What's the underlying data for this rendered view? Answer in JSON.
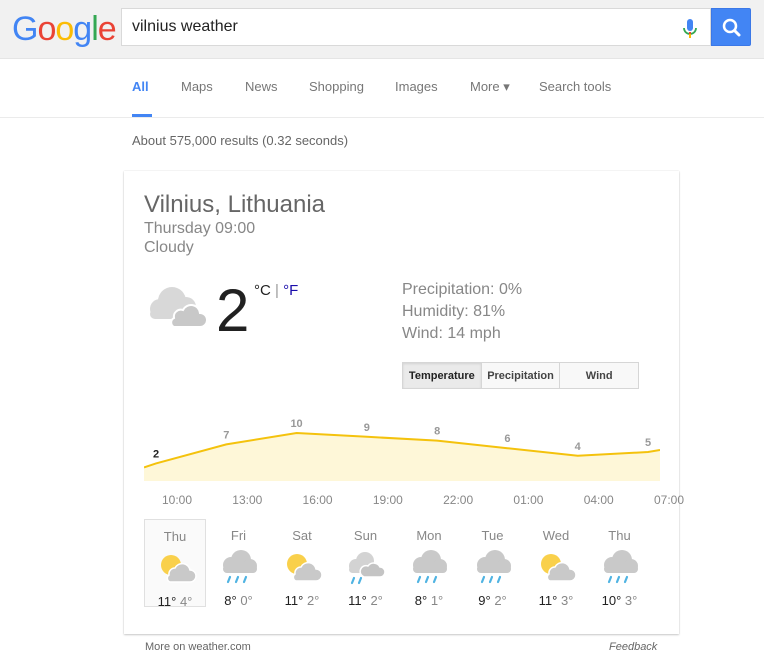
{
  "logo": {
    "letters": [
      "G",
      "o",
      "o",
      "g",
      "l",
      "e"
    ],
    "colors": [
      "#4285f4",
      "#ea4335",
      "#fbbc05",
      "#4285f4",
      "#34a853",
      "#ea4335"
    ]
  },
  "search": {
    "query": "vilnius weather"
  },
  "nav": {
    "items": [
      "All",
      "Maps",
      "News",
      "Shopping",
      "Images",
      "More ▾",
      "Search tools"
    ],
    "active": "All"
  },
  "stats": "About 575,000 results (0.32 seconds)",
  "weather": {
    "location": "Vilnius, Lithuania",
    "time": "Thursday 09:00",
    "condition": "Cloudy",
    "icon": "cloudy-icon",
    "temperature": "2",
    "unit_c": "°C",
    "unit_sep": " | ",
    "unit_f": "°F",
    "precipitation": "Precipitation: 0%",
    "humidity": "Humidity: 81%",
    "wind": "Wind: 14 mph",
    "tabs": [
      "Temperature",
      "Precipitation",
      "Wind"
    ],
    "active_tab": "Temperature",
    "hourly": {
      "labels": [
        "2",
        "7",
        "10",
        "9",
        "8",
        "6",
        "4",
        "5"
      ],
      "values": [
        2,
        7,
        10,
        9,
        8,
        6,
        4,
        5
      ],
      "times": [
        "10:00",
        "13:00",
        "16:00",
        "19:00",
        "22:00",
        "01:00",
        "04:00",
        "07:00"
      ],
      "line_color": "#f4c20d",
      "fill_color": "#fef7d8"
    },
    "daily": [
      {
        "day": "Thu",
        "icon": "partly-cloudy-icon",
        "high": "11°",
        "low": "4°",
        "selected": true
      },
      {
        "day": "Fri",
        "icon": "rain-icon",
        "high": "8°",
        "low": "0°",
        "selected": false
      },
      {
        "day": "Sat",
        "icon": "partly-cloudy-icon",
        "high": "11°",
        "low": "2°",
        "selected": false
      },
      {
        "day": "Sun",
        "icon": "showers-icon",
        "high": "11°",
        "low": "2°",
        "selected": false
      },
      {
        "day": "Mon",
        "icon": "rain-icon",
        "high": "8°",
        "low": "1°",
        "selected": false
      },
      {
        "day": "Tue",
        "icon": "rain-icon",
        "high": "9°",
        "low": "2°",
        "selected": false
      },
      {
        "day": "Wed",
        "icon": "partly-cloudy-icon",
        "high": "11°",
        "low": "3°",
        "selected": false
      },
      {
        "day": "Thu",
        "icon": "rain-icon",
        "high": "10°",
        "low": "3°",
        "selected": false
      }
    ]
  },
  "footer": {
    "source": "More on weather.com",
    "feedback": "Feedback"
  }
}
